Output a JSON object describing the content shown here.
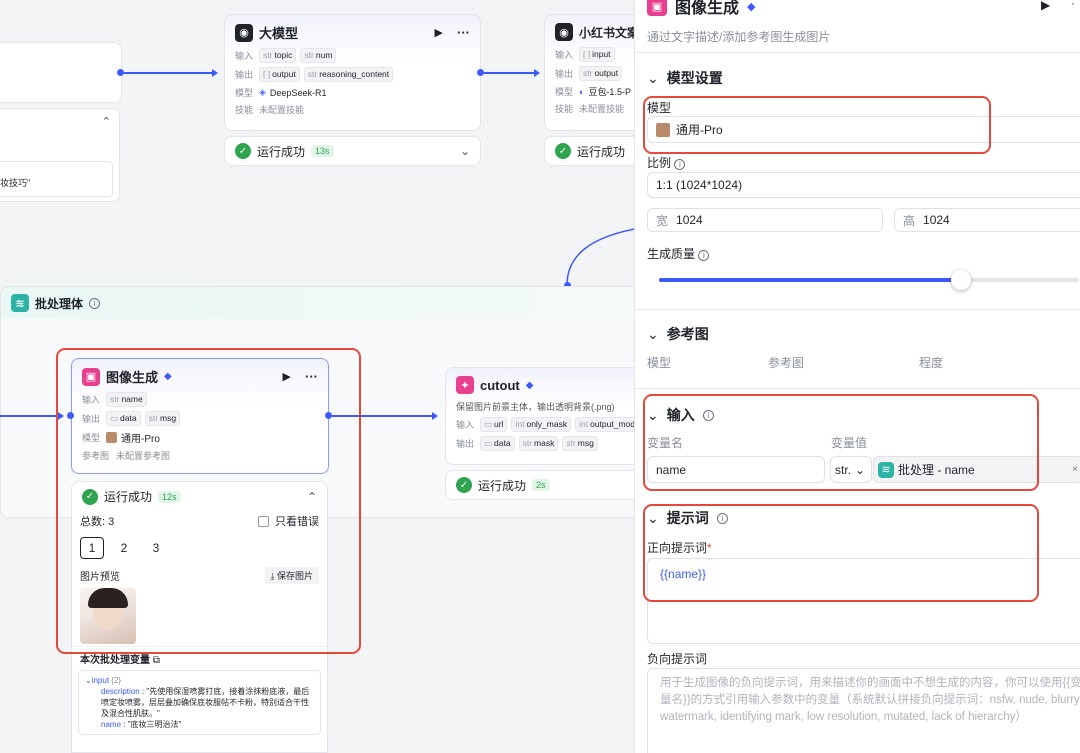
{
  "canvas": {
    "left_node": {
      "collapse_icon": "⌃",
      "text": "妆技巧\""
    },
    "llm_node": {
      "title": "大模型",
      "input_label": "输入",
      "inputs": [
        {
          "type": "str",
          "name": "topic"
        },
        {
          "type": "str",
          "name": "num"
        }
      ],
      "output_label": "输出",
      "outputs": [
        {
          "type": "[ ]",
          "name": "output"
        },
        {
          "type": "str",
          "name": "reasoning_content"
        }
      ],
      "model_label": "模型",
      "model": "DeepSeek-R1",
      "skill_label": "技能",
      "skill": "未配置技能",
      "status": "运行成功",
      "time": "13s"
    },
    "xhs_node": {
      "title": "小红书文案",
      "input_label": "输入",
      "input": {
        "type": "[ ]",
        "name": "input"
      },
      "output_label": "输出",
      "output": {
        "type": "str",
        "name": "output"
      },
      "model_label": "模型",
      "model": "豆包-1.5-P",
      "skill_label": "技能",
      "skill": "未配置技能",
      "status": "运行成功"
    },
    "batch": {
      "title": "批处理体"
    },
    "image_node": {
      "title": "图像生成",
      "input_label": "输入",
      "input": {
        "type": "str",
        "name": "name"
      },
      "output_label": "输出",
      "outputs": [
        {
          "type": "▭",
          "name": "data"
        },
        {
          "type": "str",
          "name": "msg"
        }
      ],
      "model_label": "模型",
      "model": "通用-Pro",
      "ref_label": "参考图",
      "ref": "未配置参考图",
      "status": "运行成功",
      "time": "12s",
      "total": "总数: 3",
      "only_error": "只看错误",
      "pages": [
        "1",
        "2",
        "3"
      ],
      "preview_label": "图片预览",
      "save_label": "保存图片",
      "vars_title": "本次批处理变量",
      "input_group": "input",
      "input_count": "{2}",
      "desc_key": "description",
      "desc_val": "\"先使用保湿喷雾打底，接着涂抹粉底液，最后喷定妆喷雾，层层叠加确保底妆服帖不卡粉，特别适合干性及混合性肌肤。\"",
      "name_key": "name",
      "name_val": "\"底妆三明治法\""
    },
    "cutout_node": {
      "title": "cutout",
      "desc": "保留图片前景主体，输出透明背景(.png)",
      "input_label": "输入",
      "inputs": [
        {
          "type": "▭",
          "name": "url"
        },
        {
          "type": "int",
          "name": "only_mask"
        },
        {
          "type": "int",
          "name": "output_mod"
        }
      ],
      "output_label": "输出",
      "outputs": [
        {
          "type": "▭",
          "name": "data"
        },
        {
          "type": "str",
          "name": "mask"
        },
        {
          "type": "str",
          "name": "msg"
        }
      ],
      "status": "运行成功",
      "time": "2s"
    }
  },
  "panel": {
    "title": "图像生成",
    "subtitle": "通过文字描述/添加参考图生成图片",
    "model_section": "模型设置",
    "model_label": "模型",
    "model_value": "通用-Pro",
    "ratio_label": "比例",
    "ratio_value": "1:1 (1024*1024)",
    "width_label": "宽",
    "width_value": "1024",
    "height_label": "高",
    "height_value": "1024",
    "quality_label": "生成质量",
    "quality_level": 0.72,
    "ref_section": "参考图",
    "ref_cols": [
      "模型",
      "参考图",
      "程度"
    ],
    "input_section": "输入",
    "var_name_label": "变量名",
    "var_value_label": "变量值",
    "var_name": "name",
    "var_type": "str.",
    "var_ref": "批处理 - name",
    "clear": "×",
    "prompt_section": "提示词",
    "positive_label": "正向提示词",
    "required": "*",
    "positive_value": "{{name}}",
    "negative_label": "负向提示词",
    "negative_placeholder": "用于生成图像的负向提示词，用来描述你的画面中不想生成的内容，你可以使用{{变量名}}的方式引用输入参数中的变量（系统默认拼接负向提示词：nsfw, nude, blurry, watermark, identifying mark, low resolution, mutated, lack of hierarchy）"
  },
  "colors": {
    "accent": "#3d5afe",
    "success": "#2ea44f",
    "highlight": "#e5483d",
    "brand_pink": "#e8408f"
  }
}
